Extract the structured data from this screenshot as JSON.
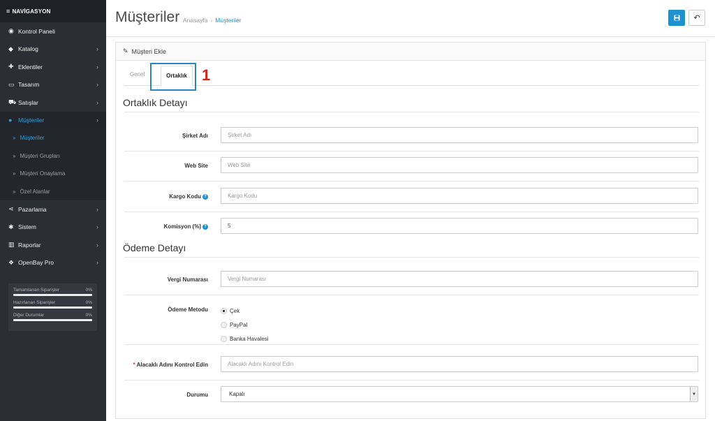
{
  "sidebar": {
    "title": "NAVİGASYON",
    "items": [
      {
        "label": "Kontrol Paneli",
        "icon": "dashboard-icon",
        "chevron": false
      },
      {
        "label": "Katalog",
        "icon": "tag-icon",
        "chevron": true
      },
      {
        "label": "Eklentiler",
        "icon": "puzzle-icon",
        "chevron": true
      },
      {
        "label": "Tasarım",
        "icon": "monitor-icon",
        "chevron": true
      },
      {
        "label": "Satışlar",
        "icon": "cart-icon",
        "chevron": true
      },
      {
        "label": "Müşteriler",
        "icon": "user-icon",
        "chevron": true,
        "active": true
      }
    ],
    "subitems": [
      {
        "label": "Müşteriler",
        "active": true
      },
      {
        "label": "Müşteri Grupları"
      },
      {
        "label": "Müşteri Onaylama"
      },
      {
        "label": "Özel Alanlar"
      }
    ],
    "items2": [
      {
        "label": "Pazarlama",
        "icon": "share-icon",
        "chevron": true
      },
      {
        "label": "Sistem",
        "icon": "cog-icon",
        "chevron": true
      },
      {
        "label": "Raporlar",
        "icon": "bar-chart-icon",
        "chevron": true
      },
      {
        "label": "OpenBay Pro",
        "icon": "cubes-icon",
        "chevron": true
      }
    ],
    "stats": [
      {
        "label": "Tamamlanan Siparişler",
        "value": "0%"
      },
      {
        "label": "Hazırlanan Siparişler",
        "value": "0%"
      },
      {
        "label": "Diğer Durumlar",
        "value": "0%"
      }
    ]
  },
  "header": {
    "title": "Müşteriler",
    "breadcrumb": [
      "Anasayfa",
      "Müşteriler"
    ],
    "breadcrumb_sep": "›"
  },
  "panel": {
    "heading": "Müşteri Ekle",
    "tabs": [
      "Genel",
      "Ortaklık"
    ],
    "annotation": "1"
  },
  "affiliate": {
    "section_title": "Ortaklık Detayı",
    "company_label": "Şirket Adı",
    "company_placeholder": "Şirket Adı",
    "website_label": "Web Site",
    "website_placeholder": "Web Site",
    "tracking_label": "Kargo Kodu",
    "tracking_placeholder": "Kargo Kodu",
    "commission_label": "Komisyon (%)",
    "commission_value": "5"
  },
  "payment": {
    "section_title": "Ödeme Detayı",
    "tax_label": "Vergi Numarası",
    "tax_placeholder": "Vergi Numarası",
    "method_label": "Ödeme Metodu",
    "methods": [
      "Çek",
      "PayPal",
      "Banka Havalesi"
    ],
    "selected_method": "Çek",
    "payee_label": "Alacaklı Adını Kontrol Edin",
    "payee_placeholder": "Alacaklı Adını Kontrol Edin",
    "status_label": "Durumu",
    "status_value": "Kapalı"
  },
  "colors": {
    "sidebar_bg": "#2b2e35",
    "accent": "#1e91cf",
    "annotation_box": "#2a86c2",
    "annotation_num": "#d0271e"
  }
}
